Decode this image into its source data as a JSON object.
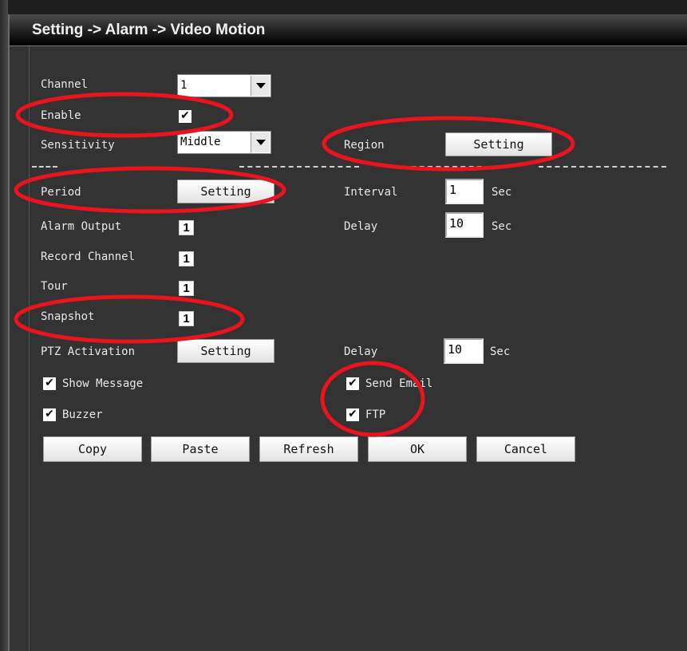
{
  "title": "Setting -> Alarm -> Video Motion",
  "channel": {
    "label": "Channel",
    "value": "1"
  },
  "enable": {
    "label": "Enable",
    "checked": true
  },
  "sensitivity": {
    "label": "Sensitivity",
    "value": "Middle"
  },
  "region": {
    "label": "Region",
    "button": "Setting"
  },
  "period": {
    "label": "Period",
    "button": "Setting"
  },
  "interval": {
    "label": "Interval",
    "value": "1",
    "unit": "Sec"
  },
  "alarm_output": {
    "label": "Alarm Output",
    "value": "1"
  },
  "delay": {
    "label": "Delay",
    "value": "10",
    "unit": "Sec"
  },
  "record_channel": {
    "label": "Record Channel",
    "value": "1"
  },
  "tour": {
    "label": "Tour",
    "value": "1"
  },
  "snapshot": {
    "label": "Snapshot",
    "value": "1"
  },
  "ptz": {
    "label": "PTZ Activation",
    "button": "Setting"
  },
  "ptz_delay": {
    "label": "Delay",
    "value": "10",
    "unit": "Sec"
  },
  "show_message": {
    "label": "Show Message",
    "checked": true
  },
  "send_email": {
    "label": "Send Email",
    "checked": true
  },
  "buzzer": {
    "label": "Buzzer",
    "checked": true
  },
  "ftp": {
    "label": "FTP",
    "checked": true
  },
  "buttons": {
    "copy": "Copy",
    "paste": "Paste",
    "refresh": "Refresh",
    "ok": "OK",
    "cancel": "Cancel"
  },
  "check_glyph": "✔",
  "colors": {
    "annotation": "#e8141e",
    "background": "#333333"
  }
}
